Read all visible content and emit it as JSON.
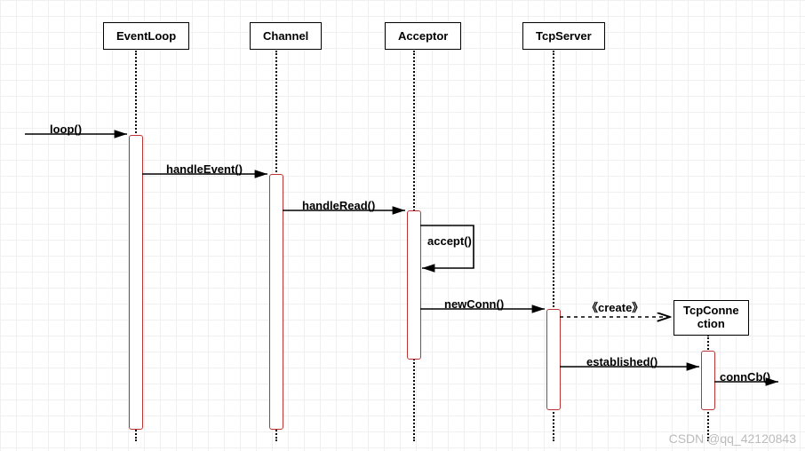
{
  "lifelines": {
    "eventloop": {
      "label": "EventLoop"
    },
    "channel": {
      "label": "Channel"
    },
    "acceptor": {
      "label": "Acceptor"
    },
    "tcpserver": {
      "label": "TcpServer"
    },
    "tcpconn": {
      "label": "TcpConne\nction"
    }
  },
  "messages": {
    "loop": "loop()",
    "handleEvent": "handleEvent()",
    "handleRead": "handleRead()",
    "accept": "accept()",
    "newConn": "newConn()",
    "create": "《create》",
    "established": "established()",
    "connCb": "connCb()"
  },
  "watermark": "CSDN @qq_42120843"
}
